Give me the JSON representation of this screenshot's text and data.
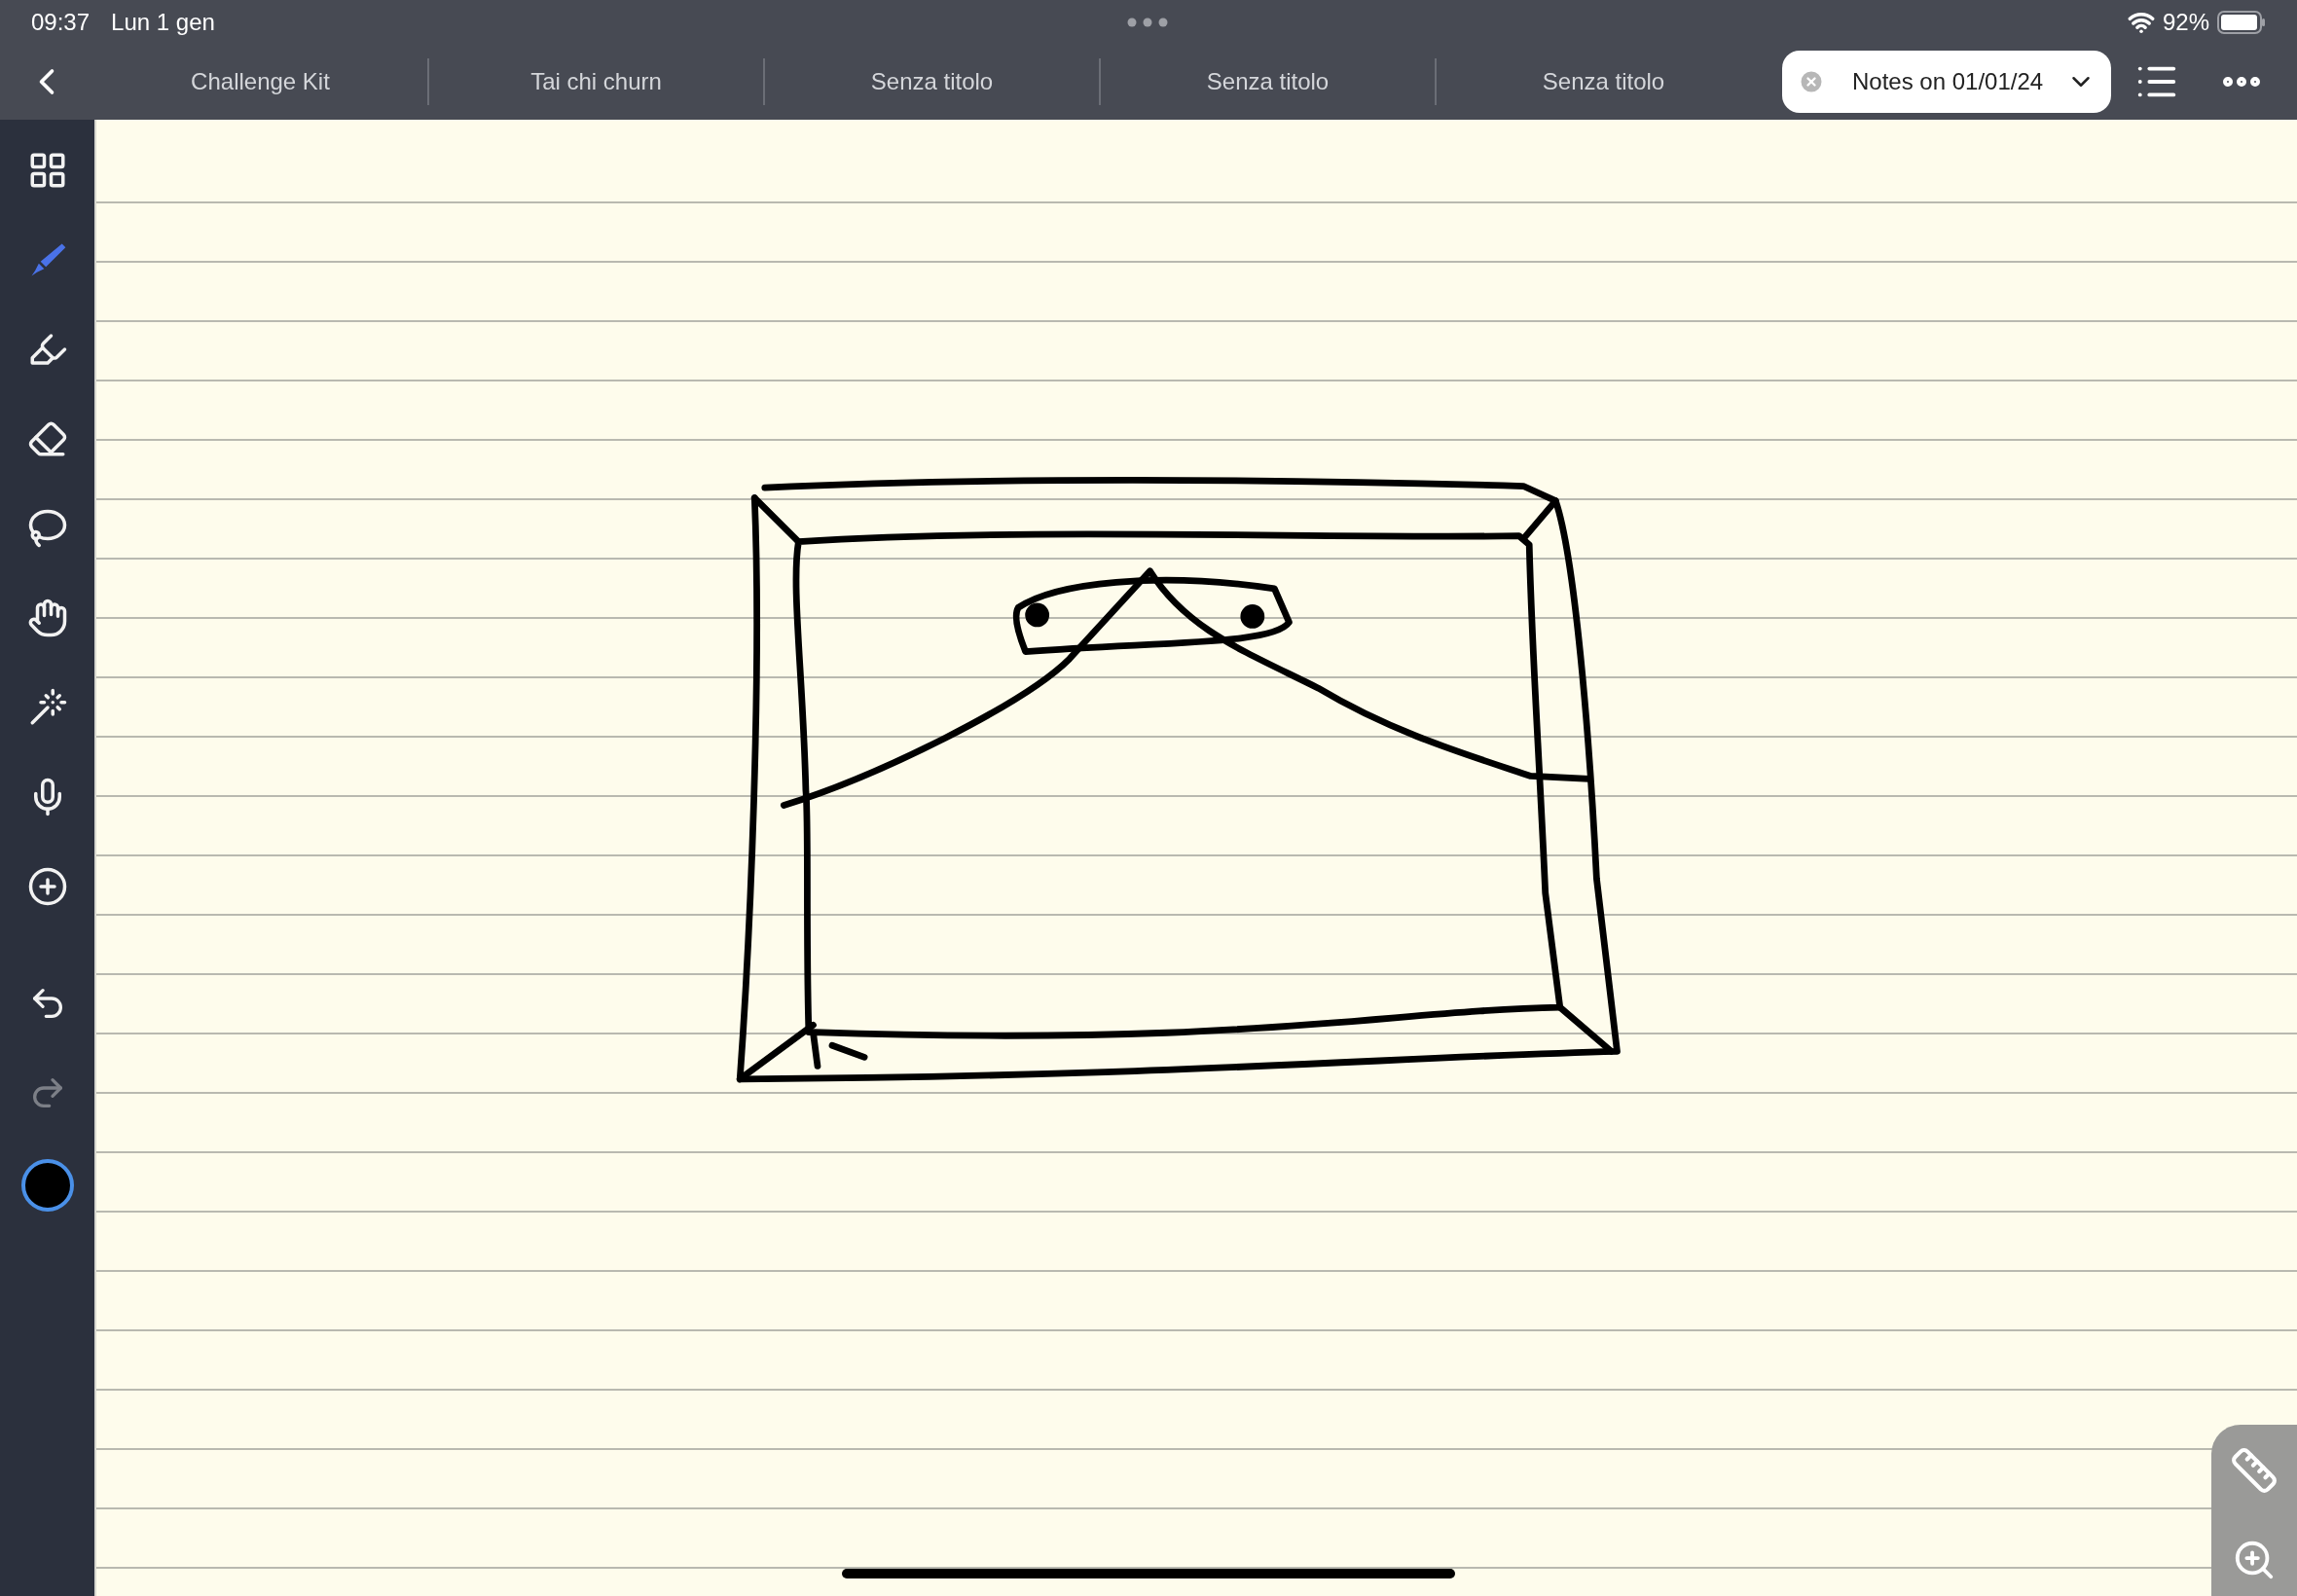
{
  "status_bar": {
    "time": "09:37",
    "date": "Lun 1 gen",
    "battery": "92%"
  },
  "tabs": [
    {
      "label": "Challenge Kit",
      "selected": false
    },
    {
      "label": "Tai chi churn",
      "selected": false
    },
    {
      "label": "Senza titolo",
      "selected": false
    },
    {
      "label": "Senza titolo",
      "selected": false
    },
    {
      "label": "Senza titolo",
      "selected": false
    },
    {
      "label": "Notes on 01/01/24",
      "selected": true
    }
  ],
  "tools": [
    {
      "selected": false
    },
    {
      "selected": true
    },
    {
      "selected": false
    },
    {
      "selected": false
    },
    {
      "selected": false
    },
    {
      "selected": false
    },
    {
      "selected": false
    },
    {
      "selected": false
    },
    {
      "selected": false
    }
  ],
  "history": [
    {
      "disabled": false
    },
    {
      "disabled": true
    }
  ],
  "pen_color": {
    "color": "#000000",
    "selected": true
  }
}
